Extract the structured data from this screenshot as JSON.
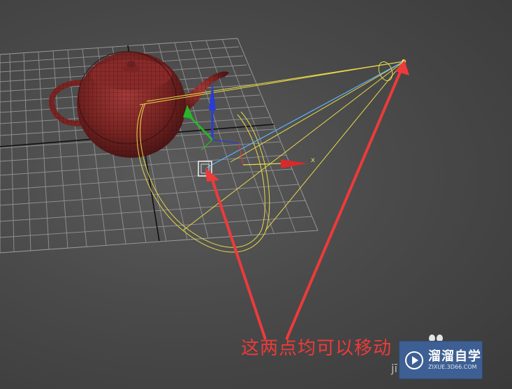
{
  "viewport": {
    "scene_objects": [
      "teapot",
      "spotlight",
      "ground-grid"
    ],
    "axis_x_label": "x"
  },
  "annotation": {
    "text": "这两点均可以移动",
    "color": "#ee3a3a"
  },
  "watermark": {
    "title": "溜溜自学",
    "url": "ZIXUE.3D66.COM",
    "partial_text": "jī",
    "bg_color": "#3d5f93"
  },
  "colors": {
    "teapot": "#8a2a2a",
    "light_lines": "#e8d84a",
    "target_line": "#5ab4ff",
    "arrow": "#ee3a3a"
  }
}
